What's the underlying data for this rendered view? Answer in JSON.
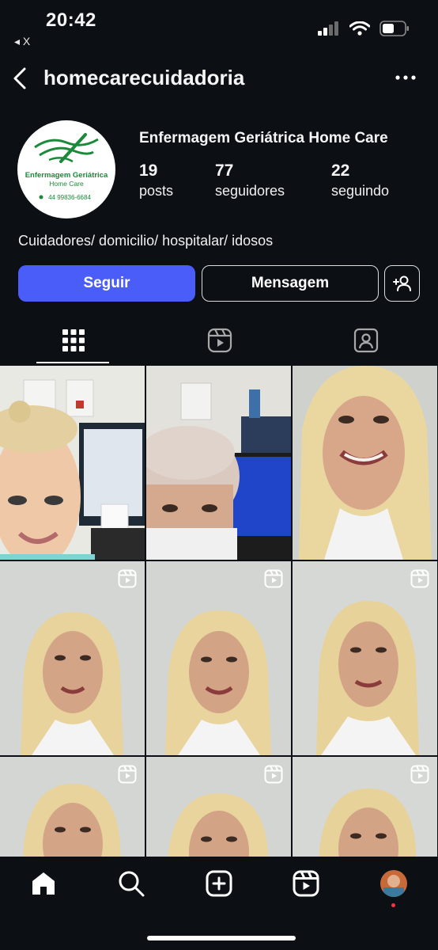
{
  "status_bar": {
    "time": "20:42",
    "back_app_label": "◂ X"
  },
  "header": {
    "username": "homecarecuidadoria"
  },
  "profile": {
    "display_name": "Enfermagem Geriátrica Home Care",
    "logo_text_line1": "Enfermagem Geriátrica",
    "logo_text_line2": "Home Care",
    "logo_phone": "44 99836-6684",
    "bio": "Cuidadores/ domicilio/ hospitalar/ idosos"
  },
  "stats": [
    {
      "value": "19",
      "label": "posts"
    },
    {
      "value": "77",
      "label": "seguidores"
    },
    {
      "value": "22",
      "label": "seguindo"
    }
  ],
  "buttons": {
    "follow": "Seguir",
    "message": "Mensagem"
  },
  "tabs": [
    "grid-icon",
    "reels-icon",
    "tagged-icon"
  ],
  "posts": [
    {
      "kind": "photo",
      "is_reel": false
    },
    {
      "kind": "photo",
      "is_reel": false
    },
    {
      "kind": "photo",
      "is_reel": false
    },
    {
      "kind": "video",
      "is_reel": true
    },
    {
      "kind": "video",
      "is_reel": true
    },
    {
      "kind": "video",
      "is_reel": true
    },
    {
      "kind": "video",
      "is_reel": true
    },
    {
      "kind": "video",
      "is_reel": true
    },
    {
      "kind": "video",
      "is_reel": true
    }
  ],
  "bottom_nav": [
    "home-icon",
    "search-icon",
    "create-icon",
    "reels-icon",
    "profile-avatar"
  ],
  "colors": {
    "background": "#0c1014",
    "accent": "#4a5df9",
    "logo_green": "#1a8a3a"
  }
}
